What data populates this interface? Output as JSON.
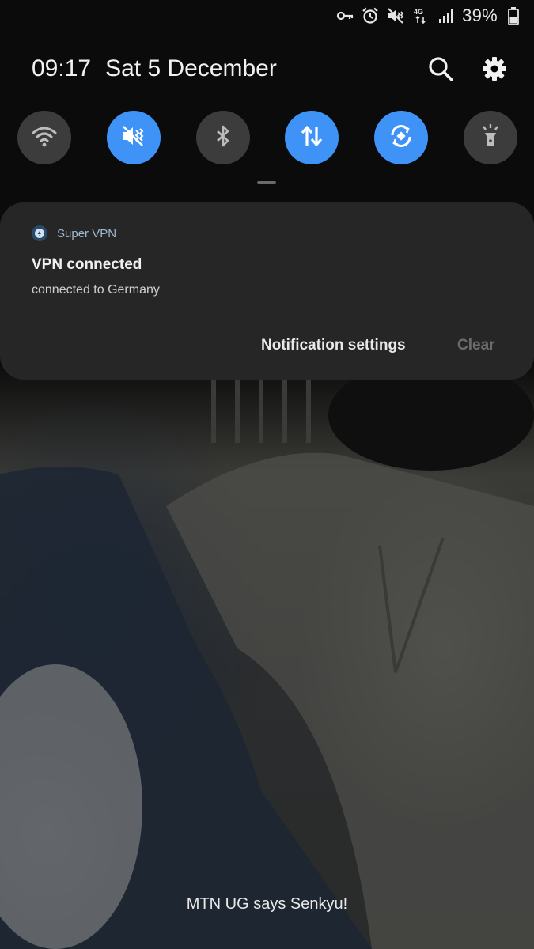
{
  "status_bar": {
    "icons": [
      "vpn-key-icon",
      "alarm-icon",
      "vibrate-icon",
      "4g-data-icon",
      "signal-icon"
    ],
    "battery_text": "39%"
  },
  "header": {
    "time": "09:17",
    "date": "Sat 5 December",
    "actions": [
      "search-icon",
      "gear-icon"
    ]
  },
  "quick_toggles": [
    {
      "name": "wifi",
      "icon": "wifi-icon",
      "state": "off"
    },
    {
      "name": "sound",
      "icon": "vibrate-icon",
      "state": "on"
    },
    {
      "name": "bluetooth",
      "icon": "bluetooth-icon",
      "state": "off"
    },
    {
      "name": "mobile-data",
      "icon": "data-arrows-icon",
      "state": "on"
    },
    {
      "name": "auto-rotate",
      "icon": "rotate-icon",
      "state": "on"
    },
    {
      "name": "flashlight",
      "icon": "flashlight-icon",
      "state": "off"
    }
  ],
  "notification": {
    "app_name": "Super VPN",
    "title": "VPN connected",
    "body": "connected to Germany",
    "settings_label": "Notification settings",
    "clear_label": "Clear"
  },
  "carrier_message": "MTN UG says Senkyu!",
  "colors": {
    "toggle_on": "#3f93f7",
    "toggle_off": "#3c3c3c",
    "card_bg": "#262626",
    "app_name": "#9fb9d3"
  }
}
